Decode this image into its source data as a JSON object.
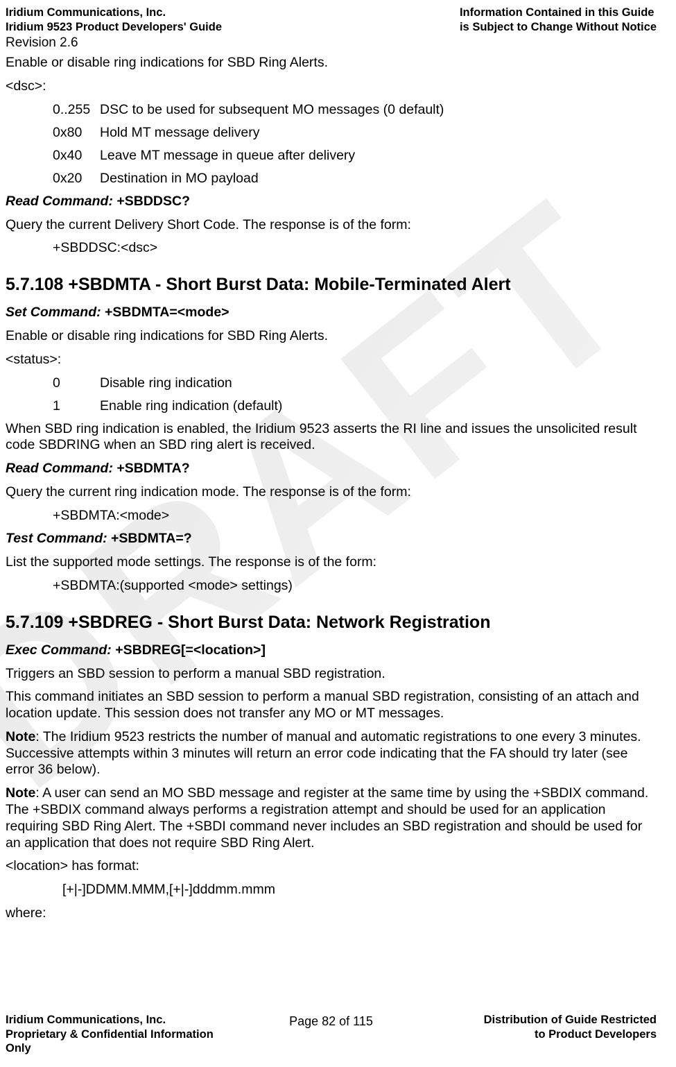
{
  "header": {
    "left_line1": "Iridium Communications, Inc.",
    "left_line2": "Iridium 9523 Product Developers' Guide",
    "right_line1": "Information Contained in this Guide",
    "right_line2": "is Subject to Change Without Notice",
    "revision": "Revision 2.6"
  },
  "body": {
    "p1": "Enable or disable ring indications for SBD Ring Alerts.",
    "dsc_label": "<dsc>:",
    "dsc_rows": [
      {
        "k": "0..255",
        "v": "DSC to be used for subsequent MO messages (0 default)"
      },
      {
        "k": "0x80",
        "v": "Hold MT message delivery"
      },
      {
        "k": "0x40",
        "v": "Leave MT message in queue after delivery"
      },
      {
        "k": "0x20",
        "v": "Destination in MO payload"
      }
    ],
    "read_cmd1_label": "Read Command:",
    "read_cmd1_value": " +SBDDSC?",
    "read_cmd1_text": "Query the current Delivery Short Code.  The response is of the form:",
    "read_cmd1_resp": "+SBDDSC:<dsc>",
    "sec108": "5.7.108  +SBDMTA - Short Burst Data: Mobile-Terminated Alert",
    "set_cmd108_label": "Set Command:",
    "set_cmd108_value": " +SBDMTA=<mode>",
    "p108a": "Enable or disable ring indications for SBD Ring Alerts.",
    "status_label": "<status>:",
    "status_rows": [
      {
        "k": "0",
        "v": "Disable ring indication"
      },
      {
        "k": "1",
        "v": "Enable ring indication (default)"
      }
    ],
    "p108b": "When SBD ring indication is enabled, the Iridium 9523 asserts the RI line and issues the unsolicited result code SBDRING when an SBD ring alert is received.",
    "read_cmd108_label": "Read Command:",
    "read_cmd108_value": " +SBDMTA?",
    "read_cmd108_text": "Query the current ring indication mode.  The response is of the form:",
    "read_cmd108_resp": "+SBDMTA:<mode>",
    "test_cmd108_label": "Test Command:",
    "test_cmd108_value": " +SBDMTA=?",
    "test_cmd108_text": "List the supported mode settings.  The response is of the form:",
    "test_cmd108_resp": "+SBDMTA:(supported <mode> settings)",
    "sec109": "5.7.109  +SBDREG - Short Burst Data: Network Registration",
    "exec_cmd109_label": "Exec Command:",
    "exec_cmd109_value": " +SBDREG[=<location>]",
    "p109a": "Triggers an SBD session to perform a manual SBD registration.",
    "p109b": "This command initiates an SBD session to perform a manual SBD registration, consisting of an attach and location update.  This session does not transfer any MO or MT messages.",
    "note1_label": "Note",
    "note1_text": ":  The Iridium 9523 restricts the number of manual and automatic registrations to one every 3 minutes.  Successive attempts within 3 minutes will return an error code indicating that the FA should try later (see error 36 below).",
    "note2_label": "Note",
    "note2_text": ":  A user can send an MO SBD message and register at the same time by using the +SBDIX command.  The +SBDIX command always performs a registration attempt and should be used for an application requiring SBD Ring Alert.  The +SBDI command never includes an SBD registration and should be used for an application that does not require SBD Ring Alert.",
    "loc_label": "<location> has format:",
    "loc_format": "[+|-]DDMM.MMM,[+|-]dddmm.mmm",
    "where": "where:"
  },
  "footer": {
    "left_line1": "Iridium Communications, Inc.",
    "left_line2": "Proprietary & Confidential Information",
    "left_line3": "Only",
    "mid": "Page 82 of 115",
    "right_line1": "Distribution of Guide Restricted",
    "right_line2": "to Product Developers"
  }
}
